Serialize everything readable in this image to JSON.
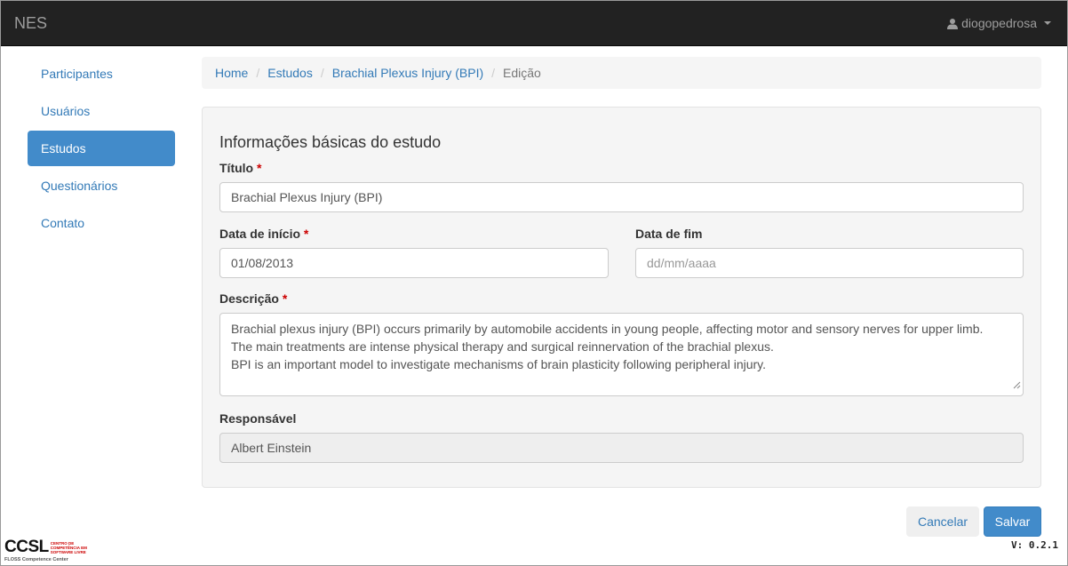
{
  "navbar": {
    "brand": "NES",
    "user": "diogopedrosa",
    "user_icon": "user-icon"
  },
  "sidebar": {
    "items": [
      {
        "label": "Participantes",
        "active": false
      },
      {
        "label": "Usuários",
        "active": false
      },
      {
        "label": "Estudos",
        "active": true
      },
      {
        "label": "Questionários",
        "active": false
      },
      {
        "label": "Contato",
        "active": false
      }
    ]
  },
  "breadcrumb": {
    "items": [
      "Home",
      "Estudos",
      "Brachial Plexus Injury (BPI)"
    ],
    "current": "Edição",
    "separator": "/"
  },
  "form": {
    "section_title": "Informações básicas do estudo",
    "required_mark": "*",
    "title_label": "Título",
    "title_value": "Brachial Plexus Injury (BPI)",
    "start_label": "Data de início",
    "start_value": "01/08/2013",
    "end_label": "Data de fim",
    "end_placeholder": "dd/mm/aaaa",
    "description_label": "Descrição",
    "description_lines": [
      "Brachial plexus injury (BPI) occurs primarily by automobile accidents in young people, affecting motor and sensory nerves for upper limb.",
      "The main treatments are intense physical therapy and surgical reinnervation of the brachial plexus.",
      "BPI is an important model to investigate mechanisms of brain plasticity following peripheral injury."
    ],
    "responsible_label": "Responsável",
    "responsible_value": "Albert Einstein"
  },
  "actions": {
    "cancel_label": "Cancelar",
    "save_label": "Salvar"
  },
  "footer": {
    "version": "V: 0.2.1",
    "logo_text": "CCSL",
    "logo_small": [
      "CENTRO DE",
      "COMPETÊNCIA EM",
      "SOFTWARE LIVRE"
    ],
    "logo_sub": "FLOSS Competence Center"
  },
  "colors": {
    "navbar": "#222222",
    "link": "#337ab7",
    "active": "#428bca",
    "required": "#cc0000"
  }
}
